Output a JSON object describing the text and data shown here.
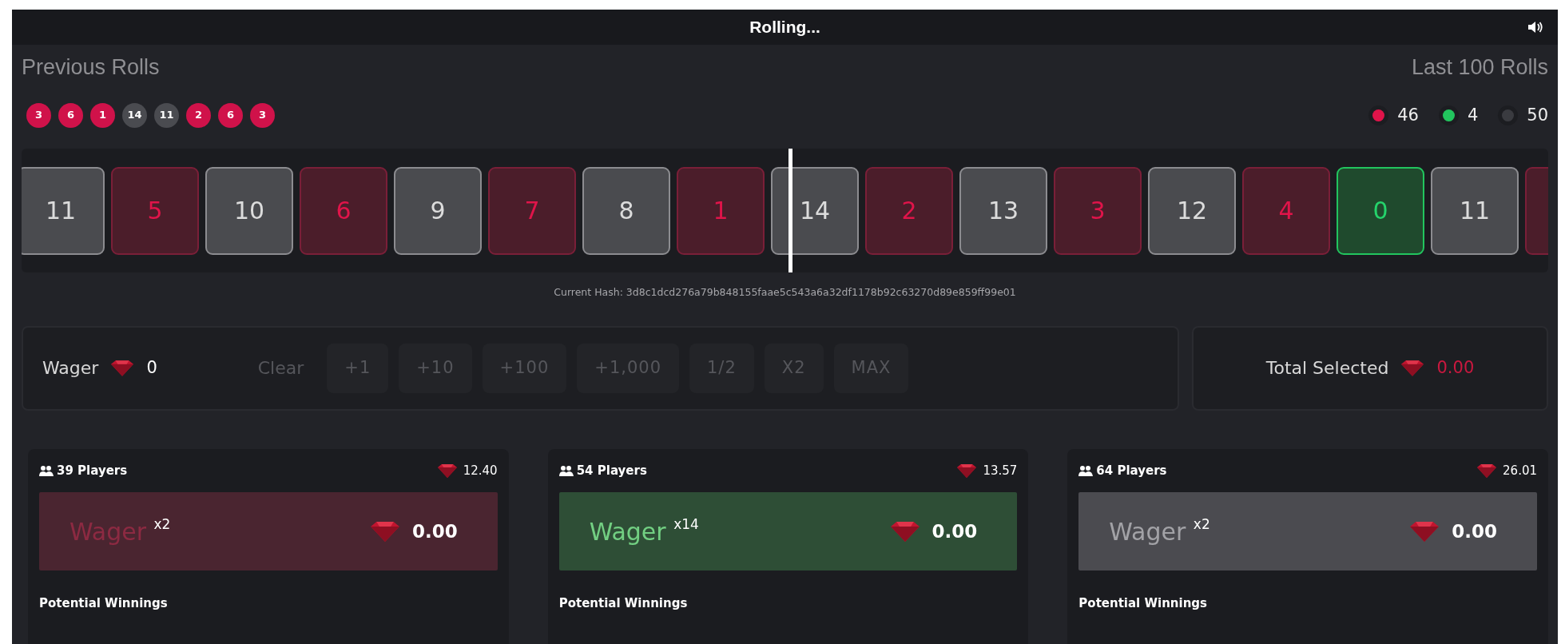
{
  "header": {
    "title": "Rolling..."
  },
  "previous_rolls": {
    "label": "Previous Rolls",
    "rolls": [
      {
        "value": "3",
        "kind": "red"
      },
      {
        "value": "6",
        "kind": "red"
      },
      {
        "value": "1",
        "kind": "red"
      },
      {
        "value": "14",
        "kind": "grey"
      },
      {
        "value": "11",
        "kind": "grey"
      },
      {
        "value": "2",
        "kind": "red"
      },
      {
        "value": "6",
        "kind": "red"
      },
      {
        "value": "3",
        "kind": "red"
      }
    ]
  },
  "last_rolls": {
    "label": "Last 100 Rolls",
    "counts": [
      {
        "color": "#e0144a",
        "count": "46"
      },
      {
        "color": "#22c55e",
        "count": "4"
      },
      {
        "color": "#3a3b40",
        "count": "50"
      }
    ]
  },
  "reel": {
    "tiles": [
      {
        "number": "11",
        "kind": "grey"
      },
      {
        "number": "5",
        "kind": "red"
      },
      {
        "number": "10",
        "kind": "grey"
      },
      {
        "number": "6",
        "kind": "red"
      },
      {
        "number": "9",
        "kind": "grey"
      },
      {
        "number": "7",
        "kind": "red"
      },
      {
        "number": "8",
        "kind": "grey"
      },
      {
        "number": "1",
        "kind": "red"
      },
      {
        "number": "14",
        "kind": "grey"
      },
      {
        "number": "2",
        "kind": "red"
      },
      {
        "number": "13",
        "kind": "grey"
      },
      {
        "number": "3",
        "kind": "red"
      },
      {
        "number": "12",
        "kind": "grey"
      },
      {
        "number": "4",
        "kind": "red"
      },
      {
        "number": "0",
        "kind": "green"
      },
      {
        "number": "11",
        "kind": "grey"
      },
      {
        "kind": "red"
      }
    ]
  },
  "hash": "Current Hash: 3d8c1dcd276a79b848155faae5c543a6a32df1178b92c63270d89e859ff99e01",
  "wager": {
    "label": "Wager",
    "amount": "0",
    "clear": {
      "label": "Clear",
      "disabled": true
    },
    "buttons": [
      {
        "label": "+1",
        "disabled": true
      },
      {
        "label": "+10",
        "disabled": true
      },
      {
        "label": "+100",
        "disabled": true
      },
      {
        "label": "+1,000",
        "disabled": true
      },
      {
        "label": "1/2",
        "disabled": true
      },
      {
        "label": "X2",
        "disabled": true
      },
      {
        "label": "MAX",
        "disabled": true
      }
    ]
  },
  "total_selected": {
    "label": "Total Selected",
    "amount": "0.00"
  },
  "bets": [
    {
      "kind": "red",
      "players": "39 Players",
      "total": "12.40",
      "label": "Wager $^{x2}$",
      "amount": "0.00",
      "footer": "Potential Winnings"
    },
    {
      "kind": "green",
      "players": "54 Players",
      "total": "13.57",
      "label": "Wager $^{x14}$",
      "amount": "0.00",
      "footer": "Potential Winnings"
    },
    {
      "kind": "grey",
      "players": "64 Players",
      "total": "26.01",
      "label": "Wager $^{x2}$",
      "amount": "0.00",
      "footer": "Potential Winnings"
    }
  ]
}
